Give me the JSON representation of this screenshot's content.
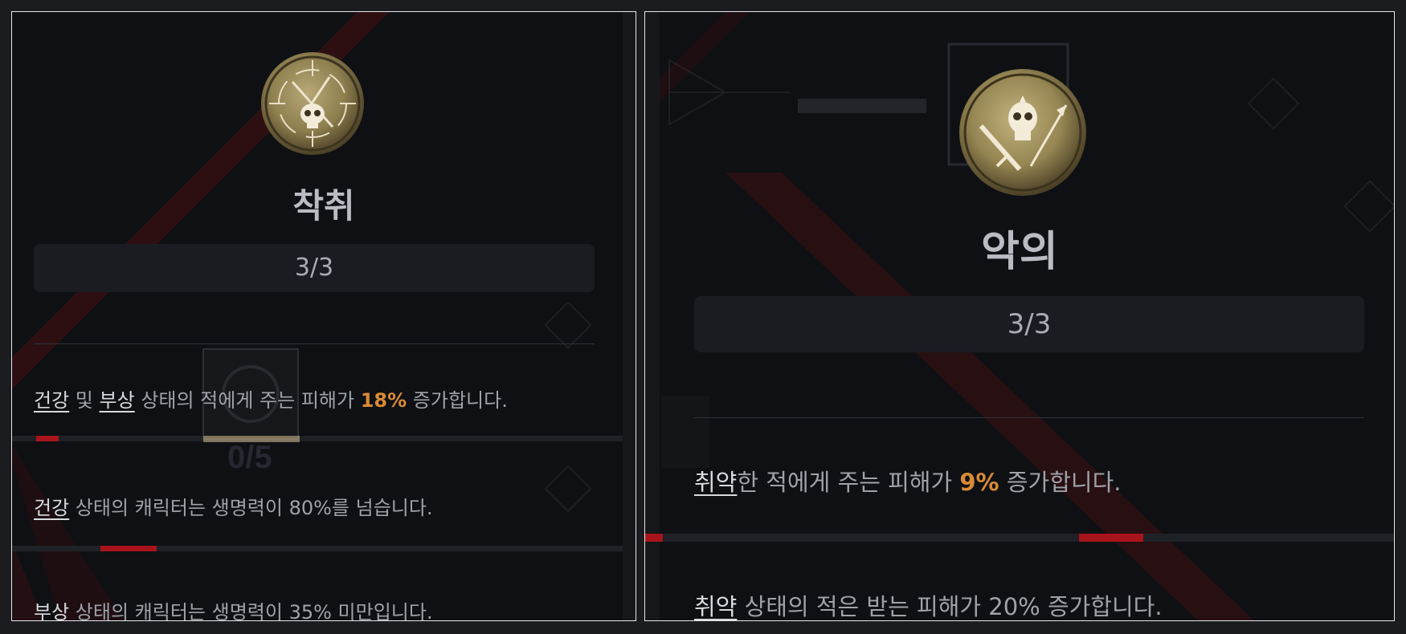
{
  "left_panel": {
    "icon": "skull-crossed-daggers-medal-icon",
    "title": "착취",
    "rank": "3/3",
    "description": {
      "keyword_a": "건강",
      "join": " 및 ",
      "keyword_b": "부상",
      "text_before": " 상태의 적에게 주는 피해가 ",
      "value": "18%",
      "text_after": " 증가합니다."
    },
    "notes": [
      {
        "keyword": "건강",
        "text": " 상태의 캐릭터는 생명력이 80%를 넘습니다."
      },
      {
        "keyword": "부상",
        "text": " 상태의 캐릭터는 생명력이 35% 미만입니다."
      }
    ],
    "background_counter": "0/5"
  },
  "right_panel": {
    "icon": "skull-sword-arrow-medal-icon",
    "title": "악의",
    "rank": "3/3",
    "description": {
      "keyword": "취약",
      "text_before": "한 적에게 주는 피해가 ",
      "value": "9%",
      "text_after": " 증가합니다."
    },
    "notes": [
      {
        "keyword": "취약",
        "text": " 상태의 적은 받는 피해가 20% 증가합니다."
      }
    ]
  },
  "colors": {
    "background": "#0e1013",
    "frame": "#e8e8ec",
    "highlight_value": "#d98a35",
    "accent_red": "#a8141b"
  }
}
